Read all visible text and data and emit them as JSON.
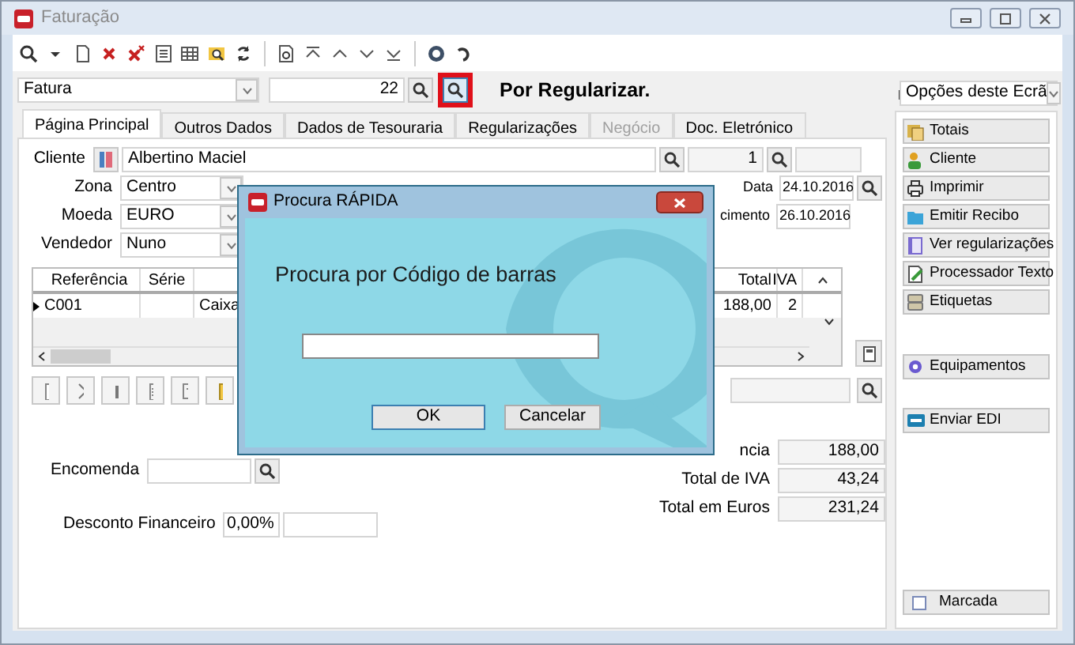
{
  "window": {
    "title": "Faturação"
  },
  "document": {
    "type": "Fatura",
    "number": "22",
    "status": "Por Regularizar."
  },
  "tabs": [
    {
      "label": "Página Principal",
      "selected": true,
      "disabled": false
    },
    {
      "label": "Outros Dados",
      "selected": false,
      "disabled": false
    },
    {
      "label": "Dados de Tesouraria",
      "selected": false,
      "disabled": false
    },
    {
      "label": "Regularizações",
      "selected": false,
      "disabled": false
    },
    {
      "label": "Negócio",
      "selected": false,
      "disabled": true
    },
    {
      "label": "Doc. Eletrónico",
      "selected": false,
      "disabled": false
    }
  ],
  "form": {
    "cliente": {
      "label": "Cliente",
      "name": "Albertino Maciel",
      "number": "1"
    },
    "selects": [
      {
        "label": "Zona",
        "value": "Centro"
      },
      {
        "label": "Moeda",
        "value": "EURO"
      },
      {
        "label": "Vendedor",
        "value": "Nuno"
      }
    ],
    "dates": [
      {
        "label": "Data",
        "value": "24.10.2016"
      },
      {
        "label": "cimento",
        "value": "26.10.2016"
      }
    ]
  },
  "table": {
    "columns": [
      {
        "label": "Referência"
      },
      {
        "label": "Série"
      },
      {},
      {
        "label": "Total"
      },
      {
        "label": "IVA"
      }
    ],
    "rows": [
      {
        "selected": true,
        "cells": [
          "C001",
          null,
          "Caixa",
          "188,00",
          "2"
        ]
      }
    ]
  },
  "order": {
    "label": "Encomenda"
  },
  "discount": {
    "label": "Desconto Financeiro",
    "value": "0,00%"
  },
  "totals": [
    {
      "label": "ncia",
      "value": "188,00"
    },
    {
      "label": "Total de IVA",
      "value": "43,24"
    },
    {
      "label": "Total em Euros",
      "value": "231,24"
    }
  ],
  "options": {
    "placeholder": "Opções deste Ecrã"
  },
  "action_groups": [
    [
      "Totais",
      "Cliente",
      "Imprimir",
      "Emitir Recibo",
      "Ver regularizações",
      "Processador Texto",
      "Etiquetas"
    ],
    [
      "Equipamentos"
    ],
    [
      "Enviar EDI"
    ]
  ],
  "marked": {
    "label": "Marcada",
    "checked": false
  },
  "dialog": {
    "title": "Procura RÁPIDA",
    "prompt": "Procura por Código de barras",
    "buttons": [
      {
        "label": "OK",
        "default": true
      },
      {
        "label": "Cancelar",
        "default": false
      }
    ]
  }
}
